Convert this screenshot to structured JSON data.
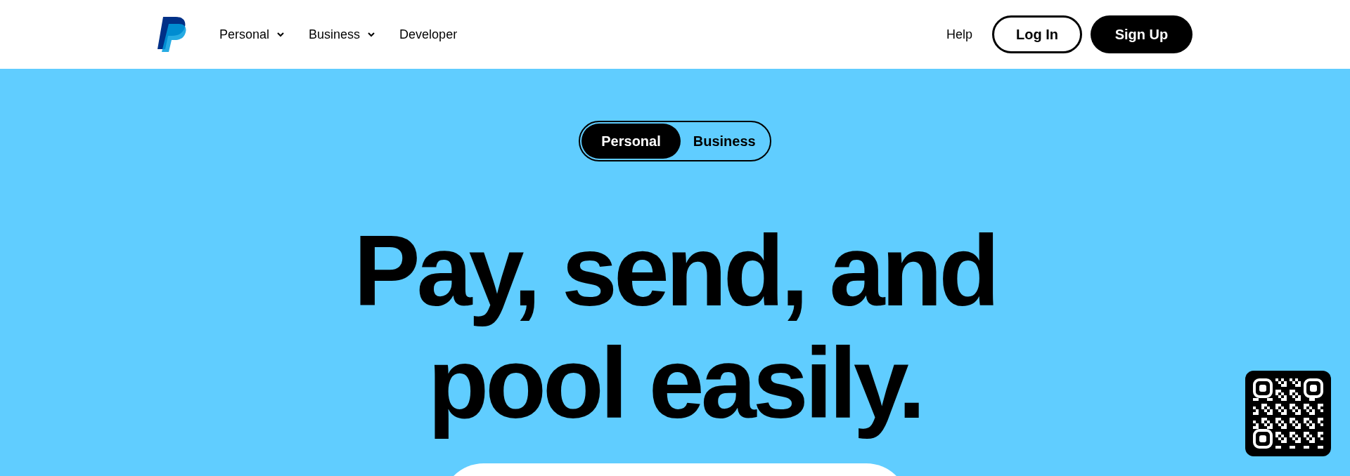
{
  "header": {
    "nav": [
      {
        "label": "Personal",
        "dropdown": true
      },
      {
        "label": "Business",
        "dropdown": true
      },
      {
        "label": "Developer",
        "dropdown": false
      }
    ],
    "help": "Help",
    "login": "Log In",
    "signup": "Sign Up"
  },
  "hero": {
    "toggle": [
      {
        "label": "Personal",
        "selected": true
      },
      {
        "label": "Business",
        "selected": false
      }
    ],
    "headline": [
      "Pay, send, and",
      "pool easily."
    ]
  }
}
